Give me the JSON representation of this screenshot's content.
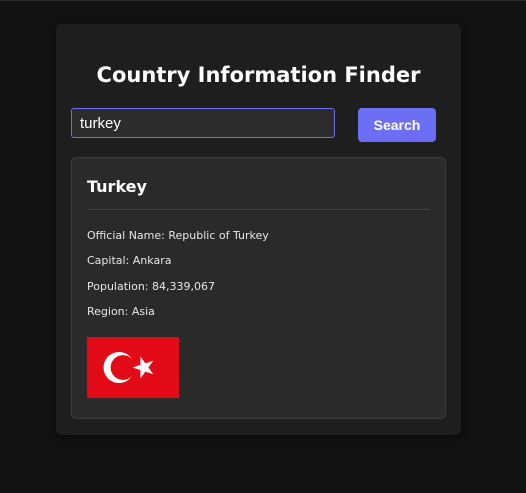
{
  "app": {
    "title": "Country Information Finder"
  },
  "search": {
    "value": "turkey",
    "button_label": "Search"
  },
  "result": {
    "name": "Turkey",
    "official_name_label": "Official Name:",
    "official_name": "Republic of Turkey",
    "capital_label": "Capital:",
    "capital": "Ankara",
    "population_label": "Population:",
    "population": "84,339,067",
    "region_label": "Region:",
    "region": "Asia",
    "flag_icon": "turkey-flag",
    "flag_colors": {
      "field": "#e30a17",
      "emblem": "#ffffff"
    }
  },
  "colors": {
    "accent": "#6c6ef5",
    "background": "#121212",
    "panel": "#1e1e1e",
    "card": "#2a2a2a"
  }
}
